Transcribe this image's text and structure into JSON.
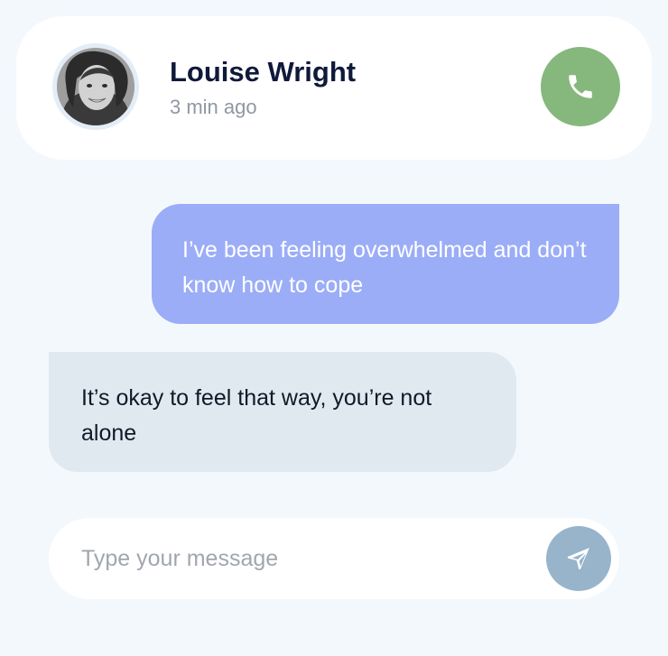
{
  "header": {
    "contact_name": "Louise Wright",
    "status": "3 min ago",
    "avatar_icon": "user-avatar-photo",
    "call_icon": "phone-icon"
  },
  "messages": [
    {
      "direction": "outgoing",
      "text": "I’ve been feeling overwhelmed and don’t know how to cope"
    },
    {
      "direction": "incoming",
      "text": "It’s okay to feel that way, you’re not alone"
    }
  ],
  "composer": {
    "placeholder": "Type your message",
    "value": "",
    "send_icon": "send-icon"
  },
  "colors": {
    "background": "#f3f8fd",
    "call_button": "#86b87e",
    "outgoing_bubble": "#9badf7",
    "incoming_bubble": "#e0e9f0",
    "send_button": "#97b4cb",
    "name_text": "#0f1a3a"
  }
}
